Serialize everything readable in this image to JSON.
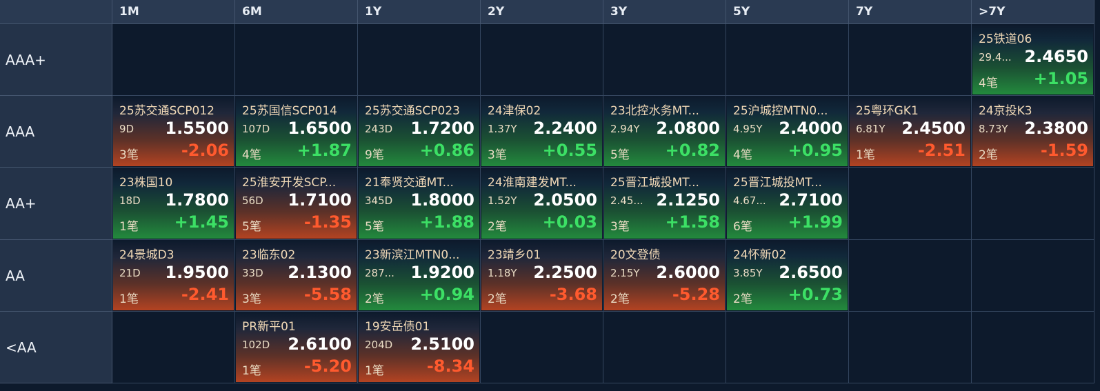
{
  "columns": [
    "1M",
    "6M",
    "1Y",
    "2Y",
    "3Y",
    "5Y",
    "7Y",
    ">7Y"
  ],
  "rows": [
    "AAA+",
    "AAA",
    "AA+",
    "AA",
    "<AA"
  ],
  "colors": {
    "header_bg": "#2a3a52",
    "rowheader_bg": "#243349",
    "grid_bg": "#0d1a2c",
    "up": "#3ce065",
    "down": "#ff5a2e"
  },
  "cells": [
    [
      null,
      null,
      null,
      null,
      null,
      null,
      null,
      {
        "name": "25铁道06",
        "term": "29.4...",
        "yield": "2.4650",
        "deals": "4笔",
        "change": "+1.05",
        "dir": "up"
      }
    ],
    [
      {
        "name": "25苏交通SCP012",
        "term": "9D",
        "yield": "1.5500",
        "deals": "3笔",
        "change": "-2.06",
        "dir": "down"
      },
      {
        "name": "25苏国信SCP014",
        "term": "107D",
        "yield": "1.6500",
        "deals": "4笔",
        "change": "+1.87",
        "dir": "up"
      },
      {
        "name": "25苏交通SCP023",
        "term": "243D",
        "yield": "1.7200",
        "deals": "9笔",
        "change": "+0.86",
        "dir": "up"
      },
      {
        "name": "24津保02",
        "term": "1.37Y",
        "yield": "2.2400",
        "deals": "3笔",
        "change": "+0.55",
        "dir": "up"
      },
      {
        "name": "23北控水务MT...",
        "term": "2.94Y",
        "yield": "2.0800",
        "deals": "5笔",
        "change": "+0.82",
        "dir": "up"
      },
      {
        "name": "25沪城控MTN0...",
        "term": "4.95Y",
        "yield": "2.4000",
        "deals": "4笔",
        "change": "+0.95",
        "dir": "up"
      },
      {
        "name": "25粤环GK1",
        "term": "6.81Y",
        "yield": "2.4500",
        "deals": "1笔",
        "change": "-2.51",
        "dir": "down"
      },
      {
        "name": "24京投K3",
        "term": "8.73Y",
        "yield": "2.3800",
        "deals": "2笔",
        "change": "-1.59",
        "dir": "down"
      }
    ],
    [
      {
        "name": "23株国10",
        "term": "18D",
        "yield": "1.7800",
        "deals": "1笔",
        "change": "+1.45",
        "dir": "up"
      },
      {
        "name": "25淮安开发SCP...",
        "term": "56D",
        "yield": "1.7100",
        "deals": "5笔",
        "change": "-1.35",
        "dir": "down"
      },
      {
        "name": "21奉贤交通MT...",
        "term": "345D",
        "yield": "1.8000",
        "deals": "5笔",
        "change": "+1.88",
        "dir": "up"
      },
      {
        "name": "24淮南建发MT...",
        "term": "1.52Y",
        "yield": "2.0500",
        "deals": "2笔",
        "change": "+0.03",
        "dir": "up"
      },
      {
        "name": "25晋江城投MT...",
        "term": "2.45...",
        "yield": "2.1250",
        "deals": "3笔",
        "change": "+1.58",
        "dir": "up"
      },
      {
        "name": "25晋江城投MT...",
        "term": "4.67...",
        "yield": "2.7100",
        "deals": "6笔",
        "change": "+1.99",
        "dir": "up"
      },
      null,
      null
    ],
    [
      {
        "name": "24景城D3",
        "term": "21D",
        "yield": "1.9500",
        "deals": "1笔",
        "change": "-2.41",
        "dir": "down"
      },
      {
        "name": "23临东02",
        "term": "33D",
        "yield": "2.1300",
        "deals": "3笔",
        "change": "-5.58",
        "dir": "down"
      },
      {
        "name": "23新滨江MTN0...",
        "term": "287...",
        "yield": "1.9200",
        "deals": "2笔",
        "change": "+0.94",
        "dir": "up"
      },
      {
        "name": "23靖乡01",
        "term": "1.18Y",
        "yield": "2.2500",
        "deals": "2笔",
        "change": "-3.68",
        "dir": "down"
      },
      {
        "name": "20文登债",
        "term": "2.15Y",
        "yield": "2.6000",
        "deals": "2笔",
        "change": "-5.28",
        "dir": "down"
      },
      {
        "name": "24怀新02",
        "term": "3.85Y",
        "yield": "2.6500",
        "deals": "2笔",
        "change": "+0.73",
        "dir": "up"
      },
      null,
      null
    ],
    [
      null,
      {
        "name": "PR新平01",
        "term": "102D",
        "yield": "2.6100",
        "deals": "1笔",
        "change": "-5.20",
        "dir": "down"
      },
      {
        "name": "19安岳债01",
        "term": "204D",
        "yield": "2.5100",
        "deals": "1笔",
        "change": "-8.34",
        "dir": "down"
      },
      null,
      null,
      null,
      null,
      null
    ]
  ]
}
